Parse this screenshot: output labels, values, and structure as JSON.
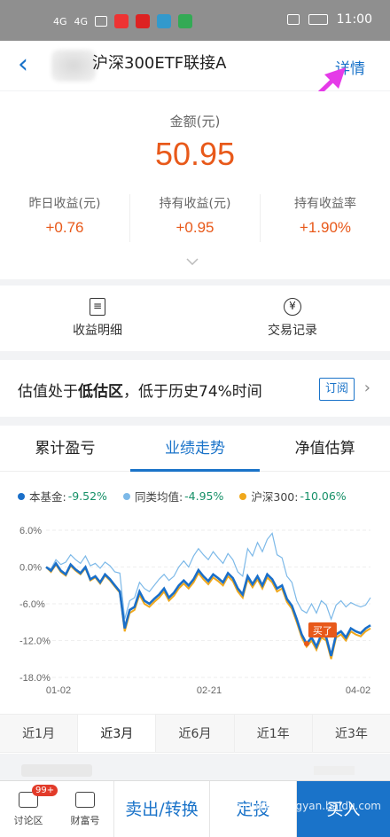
{
  "statusbar": {
    "time": "11:00",
    "sig1": "4G",
    "sig2": "4G"
  },
  "header": {
    "title": "沪深300ETF联接A",
    "detail_label": "详情"
  },
  "summary": {
    "amount_label": "金额(元)",
    "amount": "50.95",
    "metrics": [
      {
        "label": "昨日收益(元)",
        "value": "+0.76"
      },
      {
        "label": "持有收益(元)",
        "value": "+0.95"
      },
      {
        "label": "持有收益率",
        "value": "+1.90%"
      }
    ]
  },
  "actions": [
    {
      "label": "收益明细",
      "icon": "document-icon"
    },
    {
      "label": "交易记录",
      "icon": "yen-icon",
      "glyph": "¥"
    }
  ],
  "valuation": {
    "prefix": "估值处于",
    "emphasis": "低估区",
    "suffix": "，低于历史74%时间",
    "subscribe_label": "订阅"
  },
  "perf_tabs": [
    "累计盈亏",
    "业绩走势",
    "净值估算"
  ],
  "legend": [
    {
      "name": "本基金:",
      "value": "-9.52%",
      "color": "#1a6fc9"
    },
    {
      "name": "同类均值:",
      "value": "-4.95%",
      "color": "#7db9e8"
    },
    {
      "name": "沪深300:",
      "value": "-10.06%",
      "color": "#f0a81c"
    }
  ],
  "chart_data": {
    "type": "line",
    "x_ticks": [
      "01-02",
      "02-21",
      "04-02"
    ],
    "y_ticks": [
      "6.0%",
      "0.0%",
      "-6.0%",
      "-12.0%",
      "-18.0%"
    ],
    "ylim": [
      -18,
      6
    ],
    "annotation": "买了",
    "series": [
      {
        "name": "本基金",
        "color": "#1a6fc9",
        "values": [
          0,
          -0.6,
          0.6,
          -0.6,
          -1.2,
          0.4,
          -0.4,
          -1,
          0,
          -2,
          -1.5,
          -2.5,
          -1.2,
          -2,
          -3,
          -4,
          -10,
          -7,
          -6.5,
          -4,
          -5.5,
          -6,
          -5.2,
          -4.5,
          -3.5,
          -5,
          -4.2,
          -3,
          -2.2,
          -3,
          -2,
          -0.5,
          -1.5,
          -2.3,
          -1.2,
          -1.8,
          -2.5,
          -1,
          -1.8,
          -3.5,
          -4.5,
          -1.5,
          -2.8,
          -1.5,
          -3,
          -1.2,
          -2,
          -3.5,
          -3,
          -5.2,
          -6.3,
          -8.5,
          -11,
          -12.5,
          -11.5,
          -13,
          -11,
          -11.5,
          -14.5,
          -11,
          -10.5,
          -11.5,
          -10,
          -10.5,
          -10.8,
          -10,
          -9.5
        ]
      },
      {
        "name": "同类均值",
        "color": "#7db9e8",
        "values": [
          0,
          -0.3,
          1.2,
          0.4,
          0.8,
          2,
          1.2,
          0.6,
          1.8,
          0.2,
          0.6,
          -0.2,
          0.8,
          0.2,
          -0.8,
          -1,
          -8.5,
          -5.5,
          -5,
          -2.5,
          -3.5,
          -4,
          -3,
          -2,
          -1.2,
          -2.2,
          -1.5,
          0,
          1,
          0,
          1.8,
          3,
          2,
          1.2,
          2.5,
          1.5,
          0.6,
          2.2,
          1.2,
          -0.8,
          -1.5,
          3,
          1.8,
          4,
          2.5,
          4.5,
          5.5,
          2,
          1.5,
          -1.5,
          -2.5,
          -5.5,
          -7,
          -7.5,
          -6,
          -7.5,
          -5.5,
          -6.2,
          -8.5,
          -6.2,
          -5.5,
          -6.5,
          -5.8,
          -6.2,
          -6.5,
          -6.2,
          -5
        ]
      },
      {
        "name": "沪深300",
        "color": "#f0a81c",
        "values": [
          0,
          -0.8,
          0.4,
          -0.8,
          -1.4,
          0.2,
          -0.6,
          -1.2,
          -0.2,
          -2.2,
          -1.7,
          -2.7,
          -1.4,
          -2.2,
          -3.2,
          -4.2,
          -10.5,
          -7.5,
          -7,
          -4.5,
          -6,
          -6.5,
          -5.7,
          -5,
          -4,
          -5.5,
          -4.7,
          -3.5,
          -2.7,
          -3.5,
          -2.5,
          -1,
          -2,
          -2.8,
          -1.7,
          -2.3,
          -3,
          -1.5,
          -2.3,
          -4,
          -5,
          -2,
          -3.3,
          -2,
          -3.5,
          -1.7,
          -2.5,
          -4,
          -3.5,
          -5.7,
          -6.8,
          -9,
          -11.5,
          -13,
          -12,
          -13.5,
          -11.5,
          -12,
          -15,
          -11.5,
          -11,
          -12,
          -10.5,
          -11,
          -11.3,
          -10.5,
          -10
        ]
      }
    ]
  },
  "periods": [
    "近1月",
    "近3月",
    "近6月",
    "近1年",
    "近3年"
  ],
  "active_period": "近3月",
  "bottom": {
    "forum_label": "讨论区",
    "forum_badge": "99+",
    "wealth_label": "财富号",
    "sell_label": "卖出/转换",
    "plan_label": "定投",
    "buy_label": "买入"
  },
  "watermark": "Baidu经验 jingyan.baidu.com"
}
